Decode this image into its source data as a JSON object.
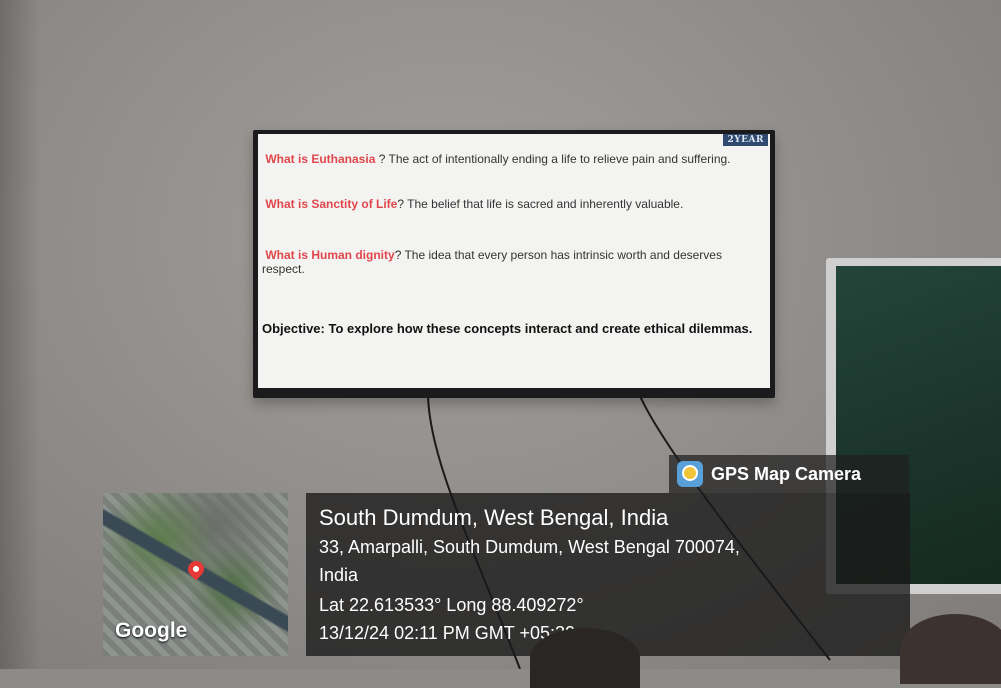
{
  "slide": {
    "badge": "2YEAR",
    "items": [
      {
        "term": "What is Euthanasia",
        "definition": " ? The act of intentionally ending a life to relieve pain and suffering."
      },
      {
        "term": "What is Sanctity of Life",
        "definition": "? The belief that life is sacred and inherently valuable."
      },
      {
        "term": "What is Human dignity",
        "definition": "? The idea that every person has intrinsic worth and deserves respect."
      }
    ],
    "objective": "Objective: To explore how these concepts interact and create ethical dilemmas."
  },
  "stamp": {
    "app_name": "GPS Map Camera",
    "app_icon": "gps-map-camera-icon",
    "map_label": "Google",
    "pin_icon": "location-pin-icon",
    "place": "South Dumdum, West Bengal, India",
    "address_line1": "33, Amarpalli, South Dumdum, West Bengal 700074,",
    "address_line2": "India",
    "coords": "Lat 22.613533° Long 88.409272°",
    "datetime": "13/12/24 02:11 PM GMT +05:30"
  },
  "colors": {
    "term_red": "#e0474c",
    "wall": "#928f8c",
    "overlay": "#191919"
  }
}
